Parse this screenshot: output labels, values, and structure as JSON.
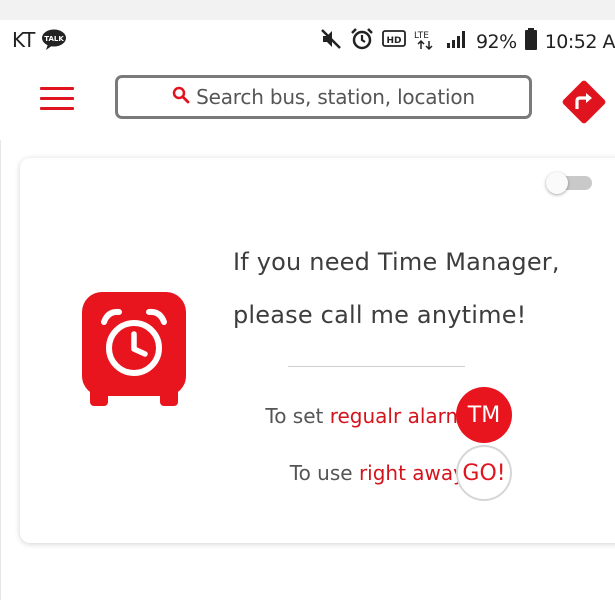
{
  "status_bar": {
    "carrier": "KT",
    "talk_badge": "TALK",
    "icons": [
      "mute-icon",
      "alarm-icon",
      "hd-icon",
      "lte-icon",
      "signal-icon",
      "battery-icon"
    ],
    "hd_label": "HD",
    "lte_label": "LTE",
    "battery": "92%",
    "time": "10:52 A"
  },
  "header": {
    "menu_icon": "hamburger-menu-icon",
    "search_placeholder": "Search bus, station, location",
    "search_icon": "search-icon",
    "directions_icon": "directions-icon"
  },
  "card": {
    "toggle_state": "off",
    "icon": "alarm-clock-bus-icon",
    "message_line1": "If you need Time Manager,",
    "message_line2": "please call me anytime!",
    "alarm_row": {
      "prefix": "To set",
      "highlight": "regualr alarm",
      "button": "TM"
    },
    "go_row": {
      "prefix": "To use",
      "highlight": "right away",
      "button": "GO!"
    }
  },
  "colors": {
    "accent": "#e0141e",
    "text": "#3d3d3d",
    "border": "#7a7a7a"
  }
}
